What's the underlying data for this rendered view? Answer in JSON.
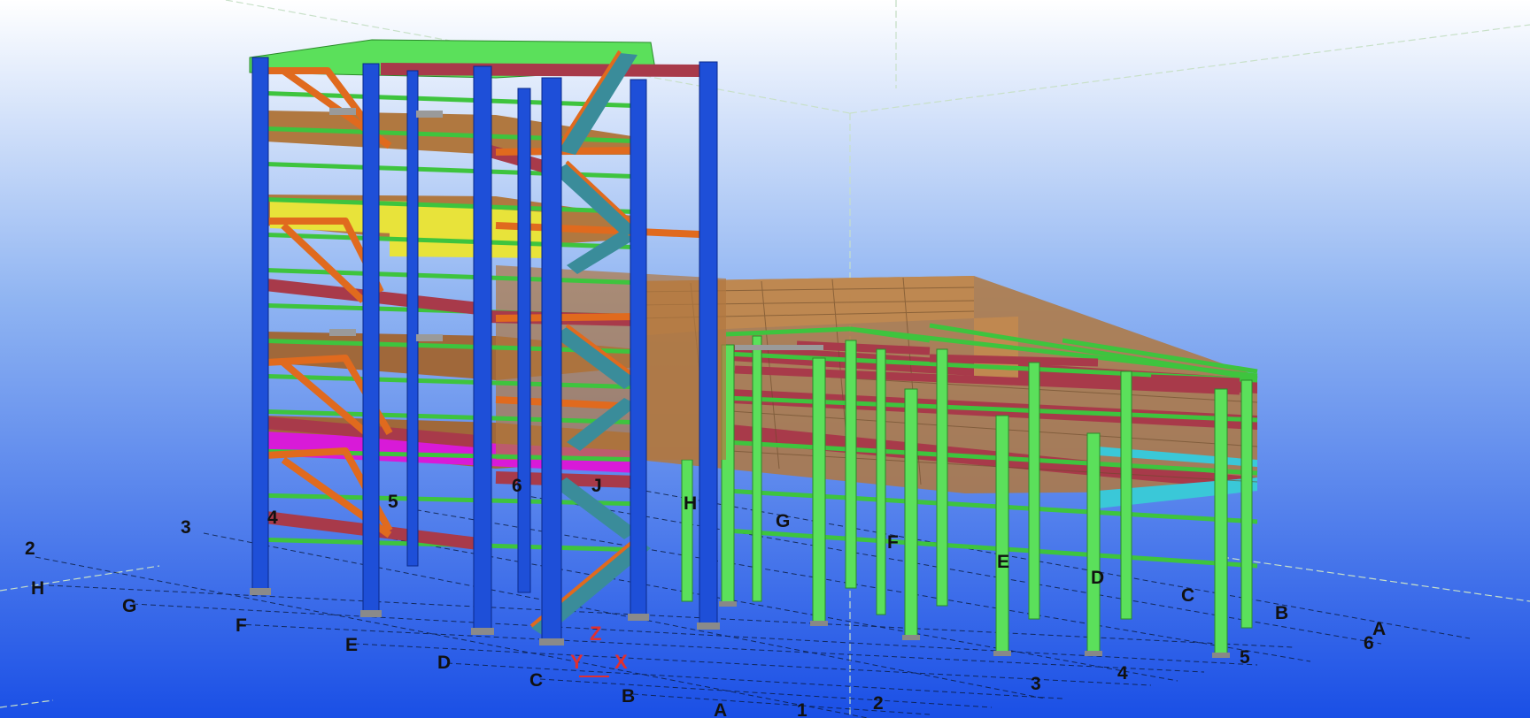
{
  "view": {
    "title": "",
    "background_top": "#ffffff",
    "background_bottom": "#1a56e8"
  },
  "grid": {
    "letters_left": [
      "H",
      "G",
      "F",
      "E",
      "D",
      "C",
      "B",
      "A"
    ],
    "numbers_left": [
      "2",
      "3",
      "4",
      "5",
      "6"
    ],
    "letters_upper": [
      "J",
      "H",
      "G",
      "F",
      "E",
      "D",
      "C",
      "B",
      "A"
    ],
    "numbers_front": [
      "1",
      "2",
      "3",
      "4",
      "5",
      "6"
    ]
  },
  "axes": {
    "z": "Z",
    "y": "Y",
    "x": "X"
  },
  "colors": {
    "column_blue": "#1e4fd8",
    "column_green": "#5be05b",
    "beam_green": "#3ec43e",
    "beam_maroon": "#a83a4a",
    "brace_orange": "#e06a1e",
    "stair_teal": "#3a8c9a",
    "equipment_yellow": "#e8e33a",
    "equipment_magenta": "#d81ad8",
    "deck_brown": "#a8703a",
    "cyan_panel": "#3ac8d8",
    "axis_red": "#e03030"
  }
}
